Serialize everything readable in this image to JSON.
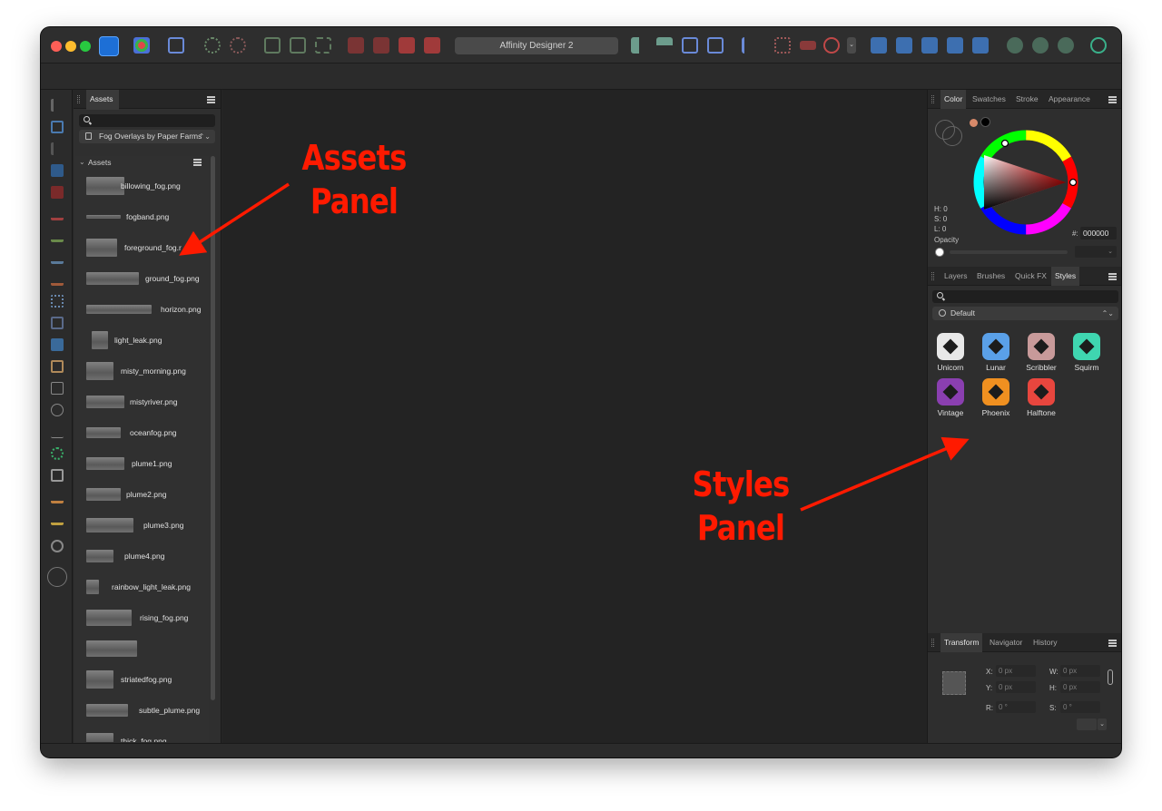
{
  "app": {
    "title": "Affinity Designer 2",
    "accent": "#1d6fd6"
  },
  "assets_panel": {
    "tab_label": "Assets",
    "category_dropdown": "Fog Overlays by Paper Farms",
    "group_title": "Assets",
    "items": [
      "billowing_fog.png",
      "fogband.png",
      "foreground_fog.r",
      "ground_fog.png",
      "horizon.png",
      "light_leak.png",
      "misty_morning.png",
      "mistyriver.png",
      "oceanfog.png",
      "plume1.png",
      "plume2.png",
      "plume3.png",
      "plume4.png",
      "rainbow_light_leak.png",
      "rising_fog.png",
      "",
      "striatedfog.png",
      "subtle_plume.png",
      "thick_fog.png"
    ]
  },
  "color_panel": {
    "tabs": [
      "Color",
      "Swatches",
      "Stroke",
      "Appearance"
    ],
    "h_label": "H: 0",
    "s_label": "S: 0",
    "l_label": "L: 0",
    "hex_label": "#:",
    "hex_value": "000000",
    "opacity_label": "Opacity"
  },
  "styles_panel": {
    "tabs": [
      "Layers",
      "Brushes",
      "Quick FX",
      "Styles"
    ],
    "category_dropdown": "Default",
    "styles": [
      {
        "label": "Unicorn",
        "color": "#e8e8e8"
      },
      {
        "label": "Lunar",
        "color": "#5aa0e8"
      },
      {
        "label": "Scribbler",
        "color": "#c89a9a"
      },
      {
        "label": "Squirm",
        "color": "#3fd6b0"
      },
      {
        "label": "Vintage",
        "color": "#8a3fb0"
      },
      {
        "label": "Phoenix",
        "color": "#f09020"
      },
      {
        "label": "Halftone",
        "color": "#e8463e"
      }
    ]
  },
  "transform_panel": {
    "tabs": [
      "Transform",
      "Navigator",
      "History"
    ],
    "x_label": "X:",
    "x_value": "0 px",
    "y_label": "Y:",
    "y_value": "0 px",
    "w_label": "W:",
    "w_value": "0 px",
    "h_label": "H:",
    "h_value": "0 px",
    "r_label": "R:",
    "r_value": "0 °",
    "s_label": "S:",
    "s_value": "0 °"
  },
  "annotations": {
    "assets_line1": "Assets",
    "assets_line2": "Panel",
    "styles_line1": "Styles",
    "styles_line2": "Panel",
    "color": "#ff1a00"
  }
}
